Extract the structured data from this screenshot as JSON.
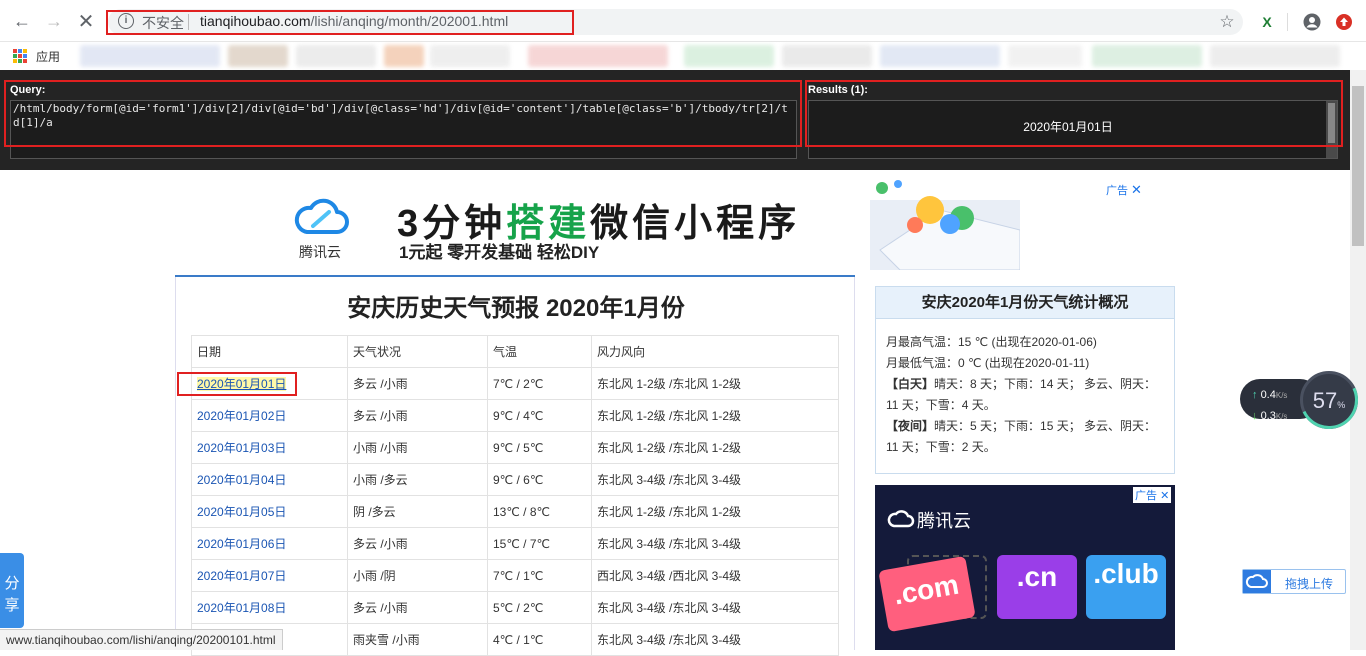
{
  "browser": {
    "omnibox": {
      "security_label": "不安全",
      "url_host": "tianqihoubao.com",
      "url_path": "/lishi/anqing/month/202001.html"
    },
    "bookmarks": {
      "apps_label": "应用"
    },
    "status_url": "www.tianqihoubao.com/lishi/anqing/20200101.html"
  },
  "xpath_helper": {
    "query_label": "Query:",
    "query_text": "/html/body/form[@id='form1']/div[2]/div[@id='bd']/div[@class='hd']/div[@id='content']/table[@class='b']/tbody/tr[2]/td[1]/a",
    "results_label": "Results (1):",
    "results": [
      "2020年01月01日"
    ]
  },
  "ad_top": {
    "brand": "腾讯云",
    "headline_a": "3分钟",
    "headline_hl": "搭建",
    "headline_b": "微信小程序",
    "subline": "1元起   零开发基础   轻松DIY",
    "tag": "广告",
    "close": "✕"
  },
  "main": {
    "title": "安庆历史天气预报 2020年1月份",
    "table": {
      "headers": [
        "日期",
        "天气状况",
        "气温",
        "风力风向"
      ],
      "rows": [
        {
          "date": "2020年01月01日",
          "weather": "多云 /小雨",
          "temp": "7℃ / 2℃",
          "wind": "东北风 1-2级 /东北风 1-2级"
        },
        {
          "date": "2020年01月02日",
          "weather": "多云 /小雨",
          "temp": "9℃ / 4℃",
          "wind": "东北风 1-2级 /东北风 1-2级"
        },
        {
          "date": "2020年01月03日",
          "weather": "小雨 /小雨",
          "temp": "9℃ / 5℃",
          "wind": "东北风 1-2级 /东北风 1-2级"
        },
        {
          "date": "2020年01月04日",
          "weather": "小雨 /多云",
          "temp": "9℃ / 6℃",
          "wind": "东北风 3-4级 /东北风 3-4级"
        },
        {
          "date": "2020年01月05日",
          "weather": "阴 /多云",
          "temp": "13℃ / 8℃",
          "wind": "东北风 1-2级 /东北风 1-2级"
        },
        {
          "date": "2020年01月06日",
          "weather": "多云 /小雨",
          "temp": "15℃ / 7℃",
          "wind": "东北风 3-4级 /东北风 3-4级"
        },
        {
          "date": "2020年01月07日",
          "weather": "小雨 /阴",
          "temp": "7℃ / 1℃",
          "wind": "西北风 3-4级 /西北风 3-4级"
        },
        {
          "date": "2020年01月08日",
          "weather": "多云 /小雨",
          "temp": "5℃ / 2℃",
          "wind": "东北风 3-4级 /东北风 3-4级"
        },
        {
          "date": "",
          "weather": "雨夹雪 /小雨",
          "temp": "4℃ / 1℃",
          "wind": "东北风 3-4级 /东北风 3-4级"
        }
      ]
    }
  },
  "stats": {
    "title": "安庆2020年1月份天气统计概况",
    "max_temp": "月最高气温：15 ℃ (出现在2020-01-06)",
    "min_temp": "月最低气温：0 ℃ (出现在2020-01-11)",
    "day_label": "【白天】",
    "day_text": "晴天：8 天；下雨：14 天；  多云、阴天：11 天；下雪：4 天。",
    "night_label": "【夜间】",
    "night_text": "晴天：5 天；下雨：15 天；  多云、阴天：11 天；下雪：2 天。"
  },
  "ad_side": {
    "brand": "腾讯云",
    "tag": "广告",
    "close": "✕",
    "tiles": [
      ".com",
      ".cn",
      ".club"
    ]
  },
  "share_tab": {
    "label": "分享"
  },
  "net_widget": {
    "up": "0.4",
    "down": "0.3",
    "unit": "K/s",
    "gauge": "57",
    "gauge_unit": "%"
  },
  "upload_button": {
    "label": "拖拽上传"
  }
}
